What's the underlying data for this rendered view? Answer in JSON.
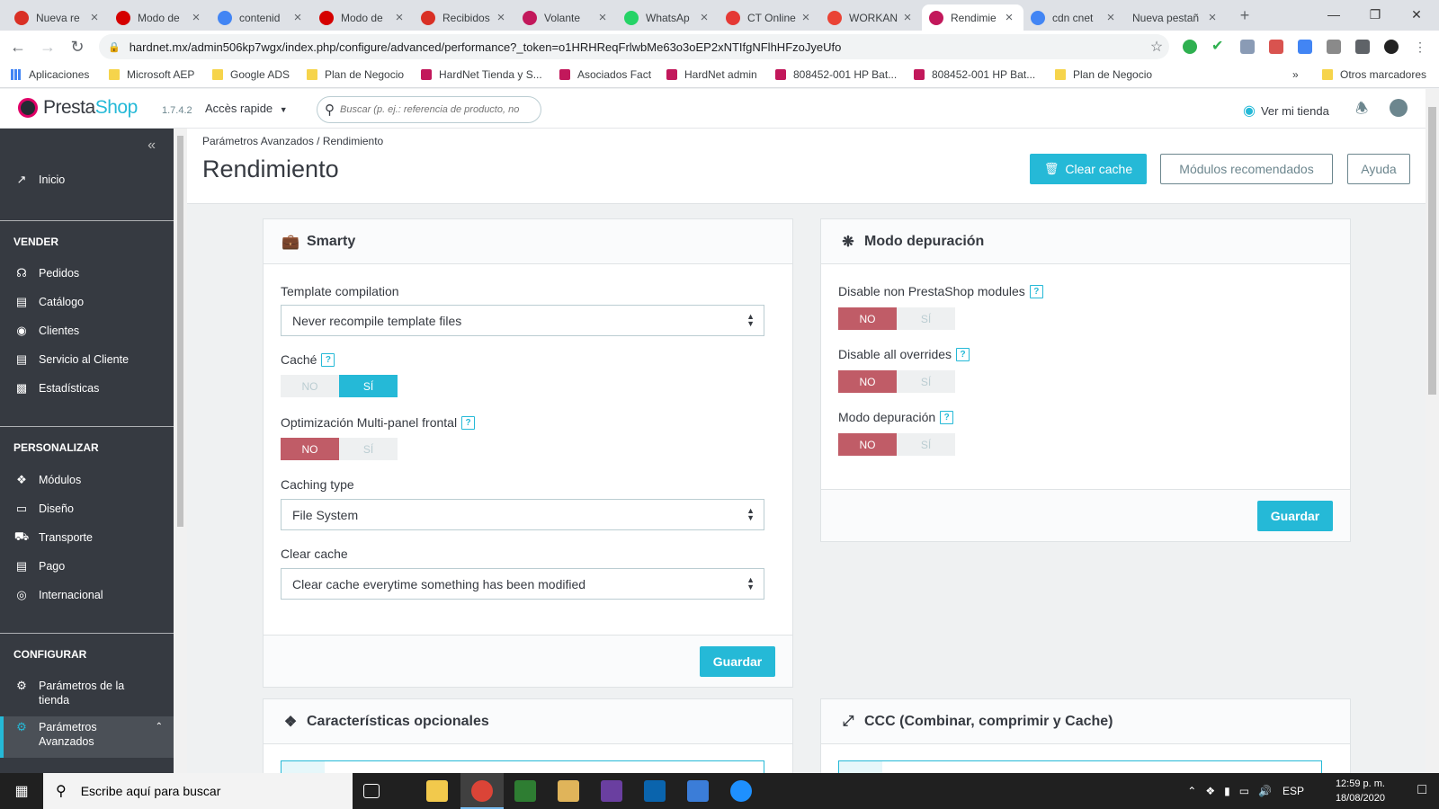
{
  "browser": {
    "tabs": [
      {
        "title": "Nueva re",
        "icon": "gmail-icon",
        "color": "#d93025"
      },
      {
        "title": "Modo de",
        "icon": "prestashop-icon",
        "color": "#d50000"
      },
      {
        "title": "contenid",
        "icon": "google-icon",
        "color": "#4285f4"
      },
      {
        "title": "Modo de",
        "icon": "prestashop-icon",
        "color": "#d50000"
      },
      {
        "title": "Recibidos",
        "icon": "gmail-icon",
        "color": "#d93025"
      },
      {
        "title": "Volante",
        "icon": "site-icon",
        "color": "#c2185b"
      },
      {
        "title": "WhatsAp",
        "icon": "whatsapp-icon",
        "color": "#25d366"
      },
      {
        "title": "CT Online",
        "icon": "site-icon",
        "color": "#e53935"
      },
      {
        "title": "WORKAN",
        "icon": "chrome-icon",
        "color": "#ea4335"
      },
      {
        "title": "Rendimie",
        "icon": "site-icon",
        "color": "#c2185b"
      },
      {
        "title": "cdn cnet",
        "icon": "google-icon",
        "color": "#4285f4"
      },
      {
        "title": "Nueva pestañ",
        "icon": "none",
        "color": "#ffffff"
      }
    ],
    "new_tab": "+",
    "url": "hardnet.mx/admin506kp7wgx/index.php/configure/advanced/performance?_token=o1HRHReqFrlwbMe63o3oEP2xNTIfgNFlhHFzoJyeUfo",
    "bookmarks": [
      {
        "label": "Aplicaciones",
        "icon": "apps-icon"
      },
      {
        "label": "Microsoft AEP",
        "icon": "folder-icon"
      },
      {
        "label": "Google ADS",
        "icon": "folder-icon"
      },
      {
        "label": "Plan de Negocio",
        "icon": "folder-icon"
      },
      {
        "label": "HardNet Tienda y S...",
        "icon": "site-icon"
      },
      {
        "label": "Asociados Fact",
        "icon": "site-icon"
      },
      {
        "label": "HardNet admin",
        "icon": "site-icon"
      },
      {
        "label": "808452-001 HP Bat...",
        "icon": "site-icon"
      },
      {
        "label": "808452-001 HP Bat...",
        "icon": "site-icon"
      },
      {
        "label": "Plan de Negocio",
        "icon": "folder-icon"
      }
    ],
    "bookmarks_more": "»",
    "other_bookmarks": "Otros marcadores"
  },
  "header": {
    "logo": "PrestaShop",
    "version": "1.7.4.2",
    "quick_access": "Accès rapide",
    "search_placeholder": "Buscar (p. ej.: referencia de producto, no",
    "view_store": "Ver mi tienda"
  },
  "sidebar": {
    "home": "Inicio",
    "sections": [
      {
        "title": "VENDER",
        "items": [
          "Pedidos",
          "Catálogo",
          "Clientes",
          "Servicio al Cliente",
          "Estadísticas"
        ]
      },
      {
        "title": "PERSONALIZAR",
        "items": [
          "Módulos",
          "Diseño",
          "Transporte",
          "Pago",
          "Internacional"
        ]
      },
      {
        "title": "CONFIGURAR",
        "items": [
          "Parámetros de la tienda",
          "Parámetros Avanzados"
        ]
      }
    ]
  },
  "page": {
    "breadcrumb": "Parámetros Avanzados  /  Rendimiento",
    "title": "Rendimiento",
    "btn_clear_cache": "Clear cache",
    "btn_modules": "Módulos recomendados",
    "btn_help": "Ayuda"
  },
  "smarty": {
    "title": "Smarty",
    "template_label": "Template compilation",
    "template_value": "Never recompile template files",
    "cache_label": "Caché",
    "multipanel_label": "Optimización Multi-panel frontal",
    "caching_type_label": "Caching type",
    "caching_type_value": "File System",
    "clear_cache_label": "Clear cache",
    "clear_cache_value": "Clear cache everytime something has been modified",
    "save": "Guardar"
  },
  "debug": {
    "title": "Modo depuración",
    "nonps_label": "Disable non PrestaShop modules",
    "overrides_label": "Disable all overrides",
    "debug_label": "Modo depuración",
    "save": "Guardar"
  },
  "switch": {
    "no": "NO",
    "yes": "SÍ"
  },
  "help_mark": "?",
  "features": {
    "title": "Características opcionales"
  },
  "ccc": {
    "title": "CCC (Combinar, comprimir y Cache)"
  },
  "taskbar": {
    "search_placeholder": "Escribe aquí para buscar",
    "lang": "ESP",
    "time": "12:59 p. m.",
    "date": "18/08/2020"
  }
}
